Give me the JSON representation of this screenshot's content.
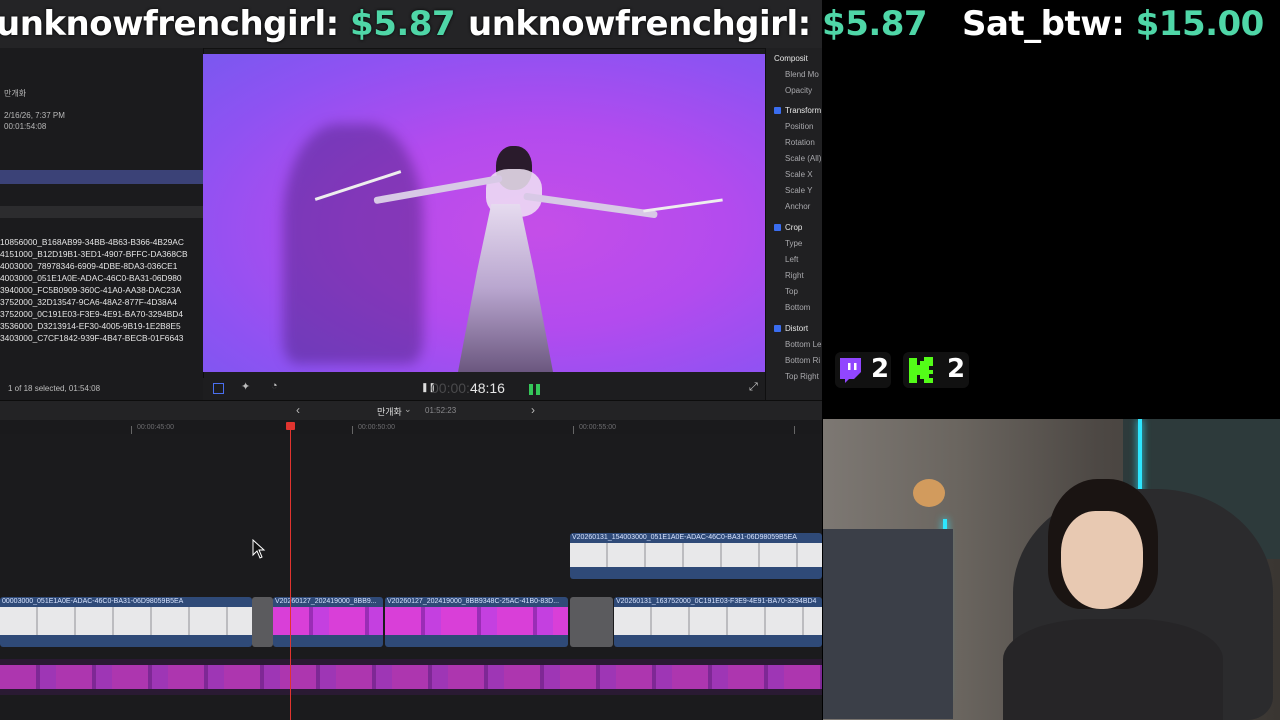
{
  "donations": [
    {
      "name": "unknowfrenchgirl",
      "amount": "$5.87"
    },
    {
      "name": "unknowfrenchgirl",
      "amount": "$5.87"
    },
    {
      "name": "Sat_btw",
      "amount": "$15.00"
    }
  ],
  "colors": {
    "donation_amount": "#4fd6a7",
    "accent_blue": "#3a6df0",
    "playhead": "#e0342f"
  },
  "browser": {
    "event_name": "만개화",
    "date": "2/16/26, 7:37 PM",
    "duration": "00:01:54:08",
    "clips": [
      "10856000_B168AB99-34BB-4B63-B366-4B29AC",
      "4151000_B12D19B1-3ED1-4907-BFFC-DA368CB",
      "4003000_78978346-6909-4DBE-8DA3-036CE1",
      "4003000_051E1A0E-ADAC-46C0-BA31-06D980",
      "3940000_FC5B0909-360C-41A0-AA38-DAC23A",
      "3752000_32D13547-9CA6-48A2-877F-4D38A4",
      "3752000_0C191E03-F3E9-4E91-BA70-3294BD4",
      "3536000_D3213914-EF30-4005-9B19-1E2B8E5",
      "3403000_C7CF1842-939F-4B47-BECB-01F6643"
    ],
    "status": "1 of 18 selected, 01:54:08"
  },
  "inspector": {
    "sections": [
      {
        "title": "Composit",
        "checked": false,
        "rows": [
          "Blend Mo",
          "Opacity"
        ]
      },
      {
        "title": "Transform",
        "checked": true,
        "rows": [
          "Position",
          "Rotation",
          "Scale (All)",
          "Scale X",
          "Scale Y",
          "Anchor"
        ]
      },
      {
        "title": "Crop",
        "checked": true,
        "rows": [
          "Type",
          "Left",
          "Right",
          "Top",
          "Bottom"
        ]
      },
      {
        "title": "Distort",
        "checked": true,
        "rows": [
          "Bottom Le",
          "Bottom Ri",
          "Top Right"
        ]
      }
    ]
  },
  "viewer": {
    "timecode_dim": "00:00:",
    "timecode": "48:16"
  },
  "timeline_nav": {
    "project_name": "만개화",
    "duration": "01:52:23"
  },
  "ruler": {
    "labels": [
      "00:00:45:00",
      "00:00:50:00",
      "00:00:55:00"
    ]
  },
  "clips": {
    "upper": "V20260131_154003000_051E1A0E-ADAC-46C0-BA31-06D98059B5EA",
    "main1": "00003000_051E1A0E-ADAC-46C0-BA31-06D98059B5EA",
    "main2": "V20260127_202419000_8BB9...",
    "main3": "V20260127_202419000_8BB9348C-25AC-41B0-83D...",
    "main4": "V20260131_163752000_0C191E03-F3E9-4E91-BA70-3294BD4"
  },
  "badges": {
    "twitch_count": "2",
    "kick_count": "2",
    "twitch_color": "#9146ff",
    "kick_color": "#53fc18"
  }
}
